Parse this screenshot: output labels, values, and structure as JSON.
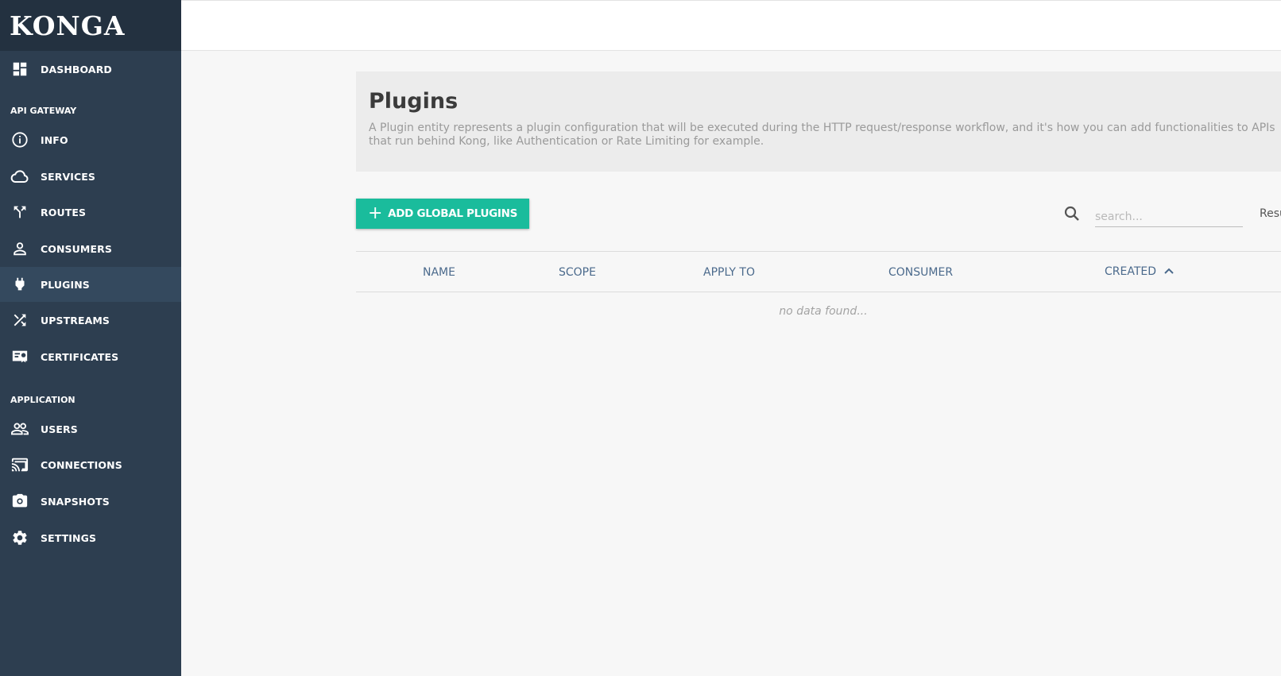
{
  "app": {
    "logo": "KONGA"
  },
  "sidebar": {
    "dashboard": "DASHBOARD",
    "sections": {
      "api_gateway": "API GATEWAY",
      "application": "APPLICATION"
    },
    "api_items": [
      {
        "label": "INFO",
        "icon": "info-icon"
      },
      {
        "label": "SERVICES",
        "icon": "cloud-icon"
      },
      {
        "label": "ROUTES",
        "icon": "routes-icon"
      },
      {
        "label": "CONSUMERS",
        "icon": "user-icon"
      },
      {
        "label": "PLUGINS",
        "icon": "plug-icon",
        "active": true
      },
      {
        "label": "UPSTREAMS",
        "icon": "shuffle-icon"
      },
      {
        "label": "CERTIFICATES",
        "icon": "certificate-icon"
      }
    ],
    "app_items": [
      {
        "label": "USERS",
        "icon": "users-icon"
      },
      {
        "label": "CONNECTIONS",
        "icon": "cast-icon"
      },
      {
        "label": "SNAPSHOTS",
        "icon": "camera-icon"
      },
      {
        "label": "SETTINGS",
        "icon": "gear-icon"
      }
    ]
  },
  "page": {
    "title": "Plugins",
    "description": "A Plugin entity represents a plugin configuration that will be executed during the HTTP request/response workflow, and it's how you can add functionalities to APIs that run behind Kong, like Authentication or Rate Limiting for example."
  },
  "toolbar": {
    "add_button": "ADD GLOBAL PLUGINS",
    "search_placeholder": "search...",
    "results_label": "Results"
  },
  "table": {
    "columns": [
      "NAME",
      "SCOPE",
      "APPLY TO",
      "CONSUMER",
      "CREATED"
    ],
    "sort_column": "CREATED",
    "sort_direction": "ascending",
    "empty_text": "no data found..."
  },
  "colors": {
    "sidebar": "#2d3e50",
    "sidebar_active": "#34495e",
    "accent": "#1abc9c",
    "header_text": "#4b6a8c"
  }
}
